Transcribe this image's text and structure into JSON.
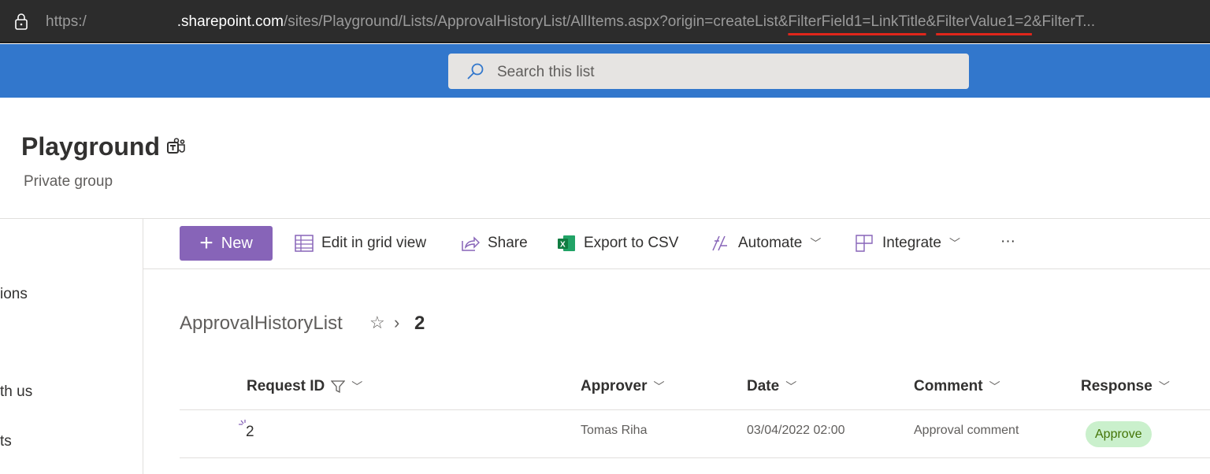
{
  "browser": {
    "url_scheme": "https:/",
    "url_host": ".sharepoint.com",
    "url_path_a": "/sites/Playground/Lists/ApprovalHistoryList/AllItems.aspx?origin=createList&",
    "url_hl1": "FilterField1=LinkTitle",
    "url_amp": "&",
    "url_hl2": "FilterValue1=2",
    "url_tail": "&FilterT...",
    "highlight_color": "#e0261b"
  },
  "search": {
    "placeholder": "Search this list"
  },
  "site": {
    "title": "Playground",
    "subtitle": "Private group"
  },
  "nav": {
    "items": [
      "ions",
      "th us",
      "ts"
    ]
  },
  "commands": {
    "new": "New",
    "grid": "Edit in grid view",
    "share": "Share",
    "export": "Export to CSV",
    "automate": "Automate",
    "integrate": "Integrate",
    "more": "···"
  },
  "breadcrumb": {
    "list": "ApprovalHistoryList",
    "current": "2"
  },
  "columns": [
    "Request ID",
    "Approver",
    "Date",
    "Comment",
    "Response"
  ],
  "rows": [
    {
      "id": "2",
      "approver": "Tomas Riha",
      "date": "03/04/2022 02:00",
      "comment": "Approval comment",
      "response": "Approve"
    }
  ],
  "colors": {
    "suite_bar": "#3277cc",
    "accent": "#8764b8",
    "approve_badge": "#caf0cc"
  }
}
